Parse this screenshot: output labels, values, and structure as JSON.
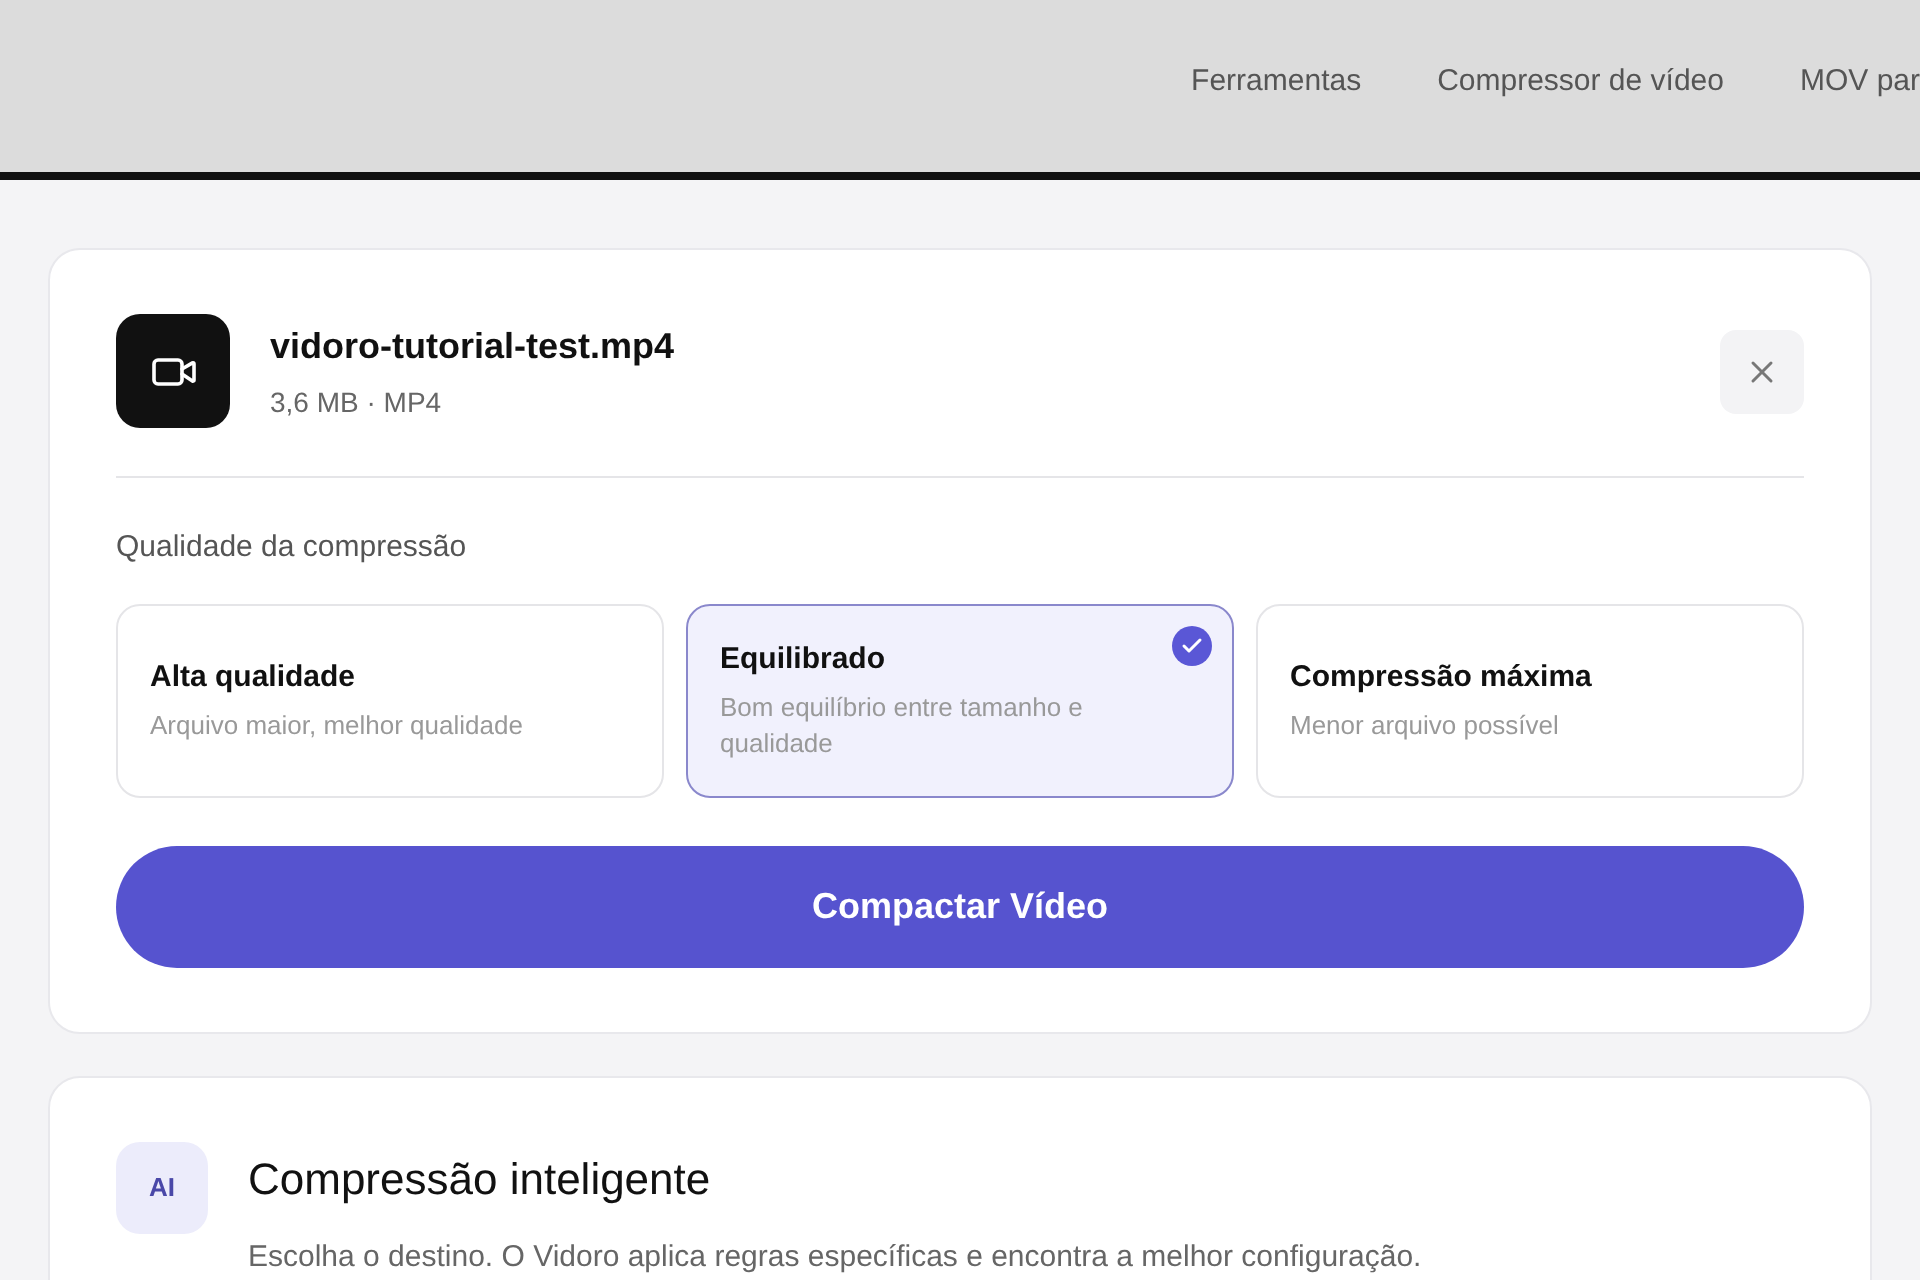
{
  "nav": [
    {
      "label": "Ferramentas"
    },
    {
      "label": "Compressor de vídeo"
    },
    {
      "label": "MOV par"
    }
  ],
  "file": {
    "name": "vidoro-tutorial-test.mp4",
    "meta": "3,6 MB · MP4"
  },
  "quality": {
    "label": "Qualidade da compressão",
    "options": [
      {
        "title": "Alta qualidade",
        "description": "Arquivo maior, melhor qualidade",
        "selected": false
      },
      {
        "title": "Equilibrado",
        "description": "Bom equilíbrio entre tamanho e qualidade",
        "selected": true
      },
      {
        "title": "Compressão máxima",
        "description": "Menor arquivo possível",
        "selected": false
      }
    ]
  },
  "action": {
    "label": "Compactar Vídeo"
  },
  "smart": {
    "badge": "AI",
    "title": "Compressão inteligente",
    "description": "Escolha o destino. O Vidoro aplica regras específicas e encontra a melhor configuração."
  }
}
